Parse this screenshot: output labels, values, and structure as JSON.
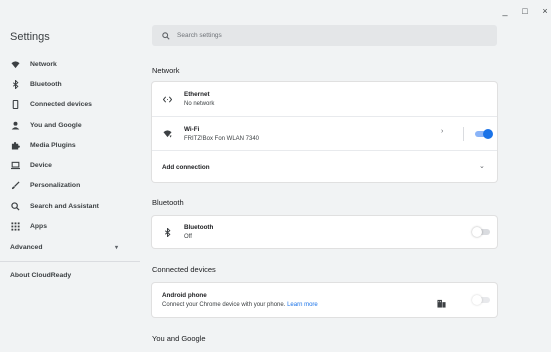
{
  "window": {
    "minimize": "_",
    "maximize": "□",
    "close": "×"
  },
  "app": {
    "title": "Settings"
  },
  "search": {
    "placeholder": "Search settings"
  },
  "sidebar": {
    "items": [
      {
        "label": "Network",
        "icon": "wifi-icon"
      },
      {
        "label": "Bluetooth",
        "icon": "bluetooth-icon"
      },
      {
        "label": "Connected devices",
        "icon": "phone-icon"
      },
      {
        "label": "You and Google",
        "icon": "person-icon"
      },
      {
        "label": "Media Plugins",
        "icon": "puzzle-icon"
      },
      {
        "label": "Device",
        "icon": "laptop-icon"
      },
      {
        "label": "Personalization",
        "icon": "brush-icon"
      },
      {
        "label": "Search and Assistant",
        "icon": "search-icon"
      },
      {
        "label": "Apps",
        "icon": "apps-grid-icon"
      }
    ],
    "advanced": "Advanced",
    "advanced_chevron": "▾",
    "about": "About CloudReady"
  },
  "network": {
    "title": "Network",
    "ethernet": {
      "name": "Ethernet",
      "status": "No network"
    },
    "wifi": {
      "name": "Wi-Fi",
      "status": "FRITZ!Box Fon WLAN 7340",
      "enabled": true
    },
    "add_connection": "Add connection"
  },
  "bluetooth": {
    "title": "Bluetooth",
    "name": "Bluetooth",
    "status": "Off",
    "enabled": false
  },
  "connected_devices": {
    "title": "Connected devices",
    "android": {
      "name": "Android phone",
      "desc": "Connect your Chrome device with your phone.",
      "link": "Learn more",
      "enabled": false
    }
  },
  "you_and_google": {
    "title": "You and Google"
  },
  "colors": {
    "accent": "#1a73e8",
    "background": "#f1f3f4",
    "card": "#ffffff"
  }
}
